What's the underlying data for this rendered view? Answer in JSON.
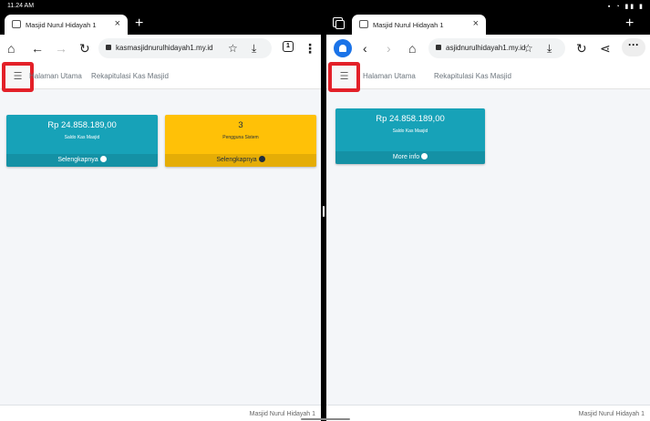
{
  "status_bar": {
    "time": "11.24 AM"
  },
  "left": {
    "tab_title": "Masjid Nurul Hidayah 1",
    "url": "kasmasjidnurulhidayah1.my.id",
    "tab_count": "1",
    "nav_links": [
      "Halaman Utama",
      "Rekapitulasi Kas Masjid"
    ],
    "cards": [
      {
        "amount": "Rp 24.858.189,00",
        "caption": "Saldo Kas Masjid",
        "footer": "Selengkapnya"
      },
      {
        "amount": "3",
        "caption": "Pengguna Sistem",
        "footer": "Selengkapnya"
      }
    ],
    "footer_text": "Masjid Nurul Hidayah 1"
  },
  "right": {
    "tab_title": "Masjid Nurul Hidayah 1",
    "url": "asjidnurulhidayah1.my.id",
    "nav_links": [
      "Halaman Utama",
      "Rekapitulasi Kas Masjid"
    ],
    "cards": [
      {
        "amount": "Rp 24.858.189,00",
        "caption": "Saldo Kas Masjid",
        "footer": "More info"
      }
    ],
    "footer_text": "Masjid Nurul Hidayah 1"
  },
  "colors": {
    "info": "#17a2b8",
    "warning": "#ffc107",
    "highlight": "#e32028",
    "incognito": "#1a73e8"
  }
}
